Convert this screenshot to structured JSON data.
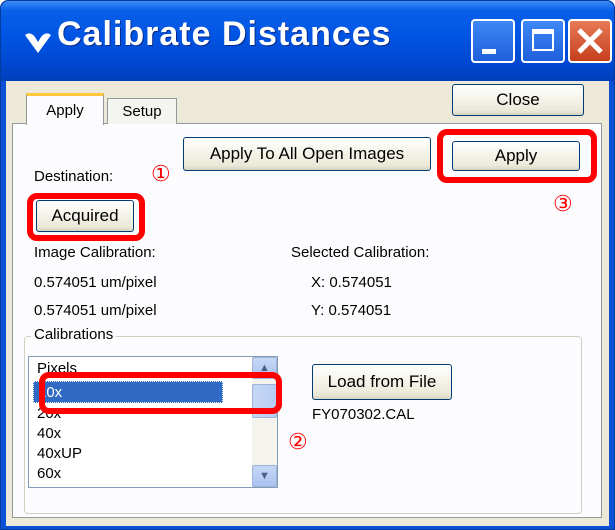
{
  "window": {
    "title": "Calibrate Distances",
    "controls": {
      "minimize": "minimize",
      "maximize": "maximize",
      "close": "close"
    }
  },
  "close_button": "Close",
  "tabs": [
    {
      "label": "Apply",
      "active": true
    },
    {
      "label": "Setup",
      "active": false
    }
  ],
  "apply_all_button": "Apply To All Open Images",
  "apply_button": "Apply",
  "destination": {
    "label": "Destination:",
    "button": "Acquired"
  },
  "image_calibration": {
    "label": "Image Calibration:",
    "x": "0.574051 um/pixel",
    "y": "0.574051 um/pixel"
  },
  "selected_calibration": {
    "label": "Selected Calibration:",
    "x": "X:  0.574051",
    "y": "Y:  0.574051"
  },
  "calibrations": {
    "group_label": "Calibrations",
    "items": [
      "Pixels",
      "10x",
      "20x",
      "40x",
      "40xUP",
      "60x"
    ],
    "selected": "10x",
    "load_button": "Load from File",
    "file_name": "FY070302.CAL"
  },
  "annotations": {
    "one": "①",
    "two": "②",
    "three": "③"
  },
  "colors": {
    "titlebar": "#0054e3",
    "selection": "#316ac5",
    "highlight": "#ff0000",
    "dialog": "#ece9d8"
  }
}
